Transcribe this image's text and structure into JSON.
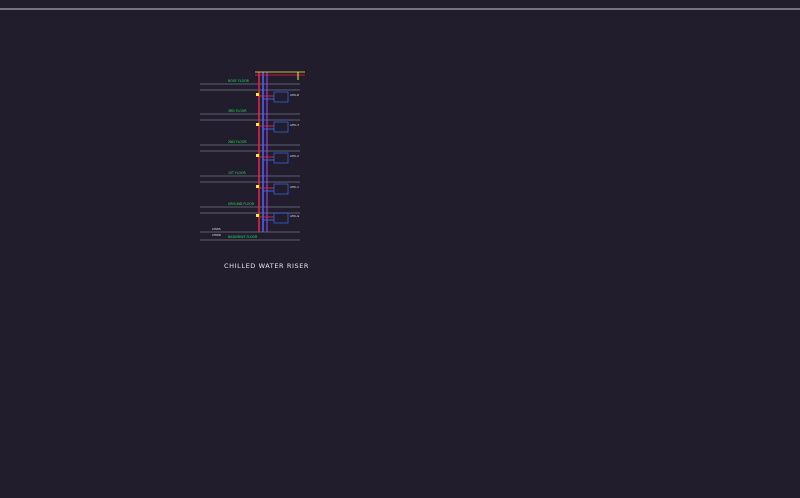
{
  "drawing": {
    "riser_title": "CHILLED WATER RISER",
    "plant_label": "",
    "background": "#211d2c"
  },
  "colors": {
    "supply": "#3a6cf0",
    "return": "#e8204a",
    "secondary": "#b23cff",
    "annotation": "#22e05a",
    "accent": "#ffe84a",
    "cyan": "#35d8e8",
    "outline": "#8a8ab0",
    "text": "#e8e8ee"
  }
}
